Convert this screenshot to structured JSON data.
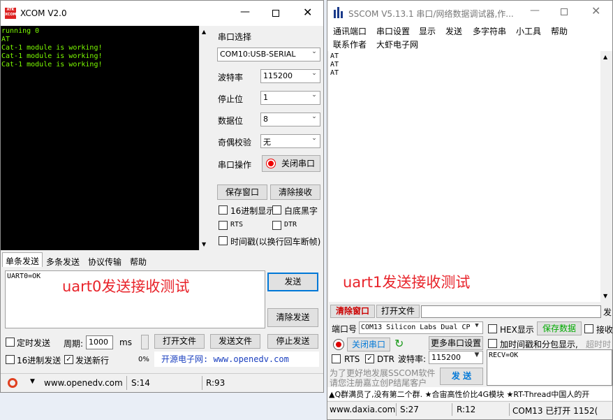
{
  "xcom": {
    "logo_text": "ATK\nXCOM",
    "title": "XCOM V2.0",
    "console_lines": [
      "running 0",
      "AT",
      "Cat-1 module is working!",
      "Cat-1 module is working!",
      "Cat-1 module is working!"
    ],
    "port_select_label": "串口选择",
    "port_value": "COM10:USB-SERIAL",
    "baud_label": "波特率",
    "baud_value": "115200",
    "stop_label": "停止位",
    "stop_value": "1",
    "data_label": "数据位",
    "data_value": "8",
    "parity_label": "奇偶校验",
    "parity_value": "无",
    "op_label": "串口操作",
    "close_port_label": "关闭串口",
    "save_window_label": "保存窗口",
    "clear_recv_label": "清除接收",
    "hex_display_label": "16进制显示",
    "white_bg_label": "白底黑字",
    "rts_label": "RTS",
    "dtr_label": "DTR",
    "timestamp_label": "时间戳(以换行回车断帧)",
    "tabs": [
      "单条发送",
      "多条发送",
      "协议传输",
      "帮助"
    ],
    "send_text": "UART0=OK",
    "overlay_text": "uart0发送接收测试",
    "send_label": "发送",
    "clear_send_label": "清除发送",
    "timed_send_label": "定时发送",
    "period_label": "周期:",
    "period_value": "1000",
    "ms_label": "ms",
    "open_file_label": "打开文件",
    "send_file_label": "发送文件",
    "stop_send_label": "停止发送",
    "hex_send_label": "16进制发送",
    "send_newline_label": "发送新行",
    "percent": "0%",
    "link_text": "开源电子网: www.openedv.com",
    "status_url": "www.openedv.com",
    "status_s": "S:14",
    "status_r": "R:93"
  },
  "sscom": {
    "title": "SSCOM V5.13.1 串口/网络数据调试器,作...",
    "menu_row1": [
      "通讯端口",
      "串口设置",
      "显示",
      "发送",
      "多字符串",
      "小工具",
      "帮助"
    ],
    "menu_row2": [
      "联系作者",
      "大虾电子网"
    ],
    "recv_lines": [
      "AT",
      "AT",
      "AT"
    ],
    "overlay_text": "uart1发送接收测试",
    "clear_window_label": "清除窗口",
    "open_file_label": "打开文件",
    "send_cut": "发",
    "port_label": "端口号",
    "port_value": "COM13 Silicon Labs Dual CP",
    "hex_display_label": "HEX显示",
    "save_data_label": "保存数据",
    "recv_cut": "接收",
    "more_settings_label": "更多串口设置",
    "close_port_label": "关闭串口",
    "timestamp_label": "加时间戳和分包显示,",
    "timeout_cut": "超时时",
    "rts_label": "RTS",
    "dtr_label": "DTR",
    "baud_label": "波特率:",
    "baud_value": "115200",
    "send_text": "RECV=OK",
    "promo_line1": "为了更好地发展SSCOM软件",
    "promo_line2": "请您注册嘉立创P结尾客户",
    "send_label": "发 送",
    "ticker": "▲Q群满员了,没有第二个群. ★合宙高性价比4G模块 ★RT-Thread中国人的开",
    "status_url": "www.daxia.com",
    "status_s": "S:27",
    "status_r": "R:12",
    "status_port": "COM13 已打开  1152("
  },
  "colors": {
    "accent_blue": "#0078d7",
    "overlay_red": "#e8232a",
    "console_green": "#7cfc00",
    "link_blue": "#1a3fbf"
  }
}
